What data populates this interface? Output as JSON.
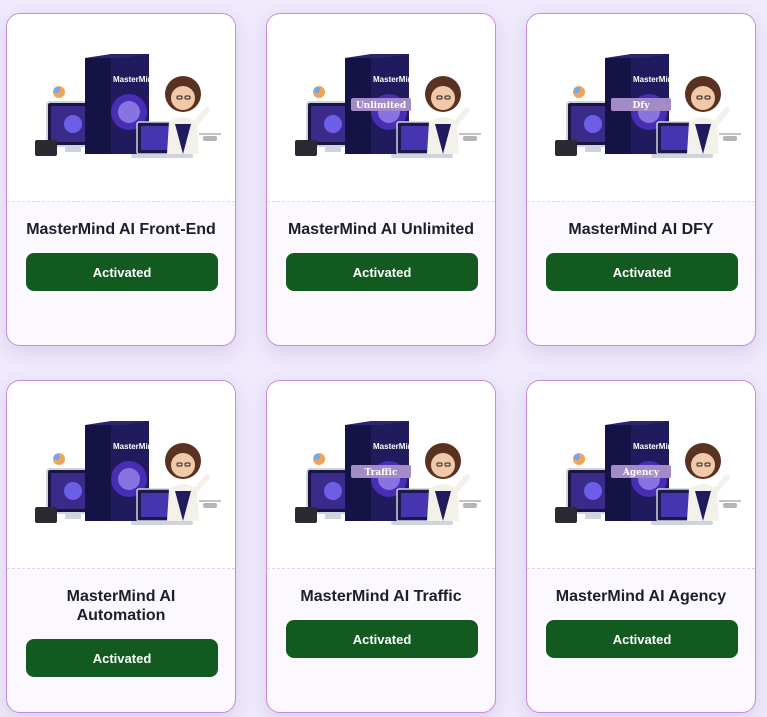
{
  "cards": [
    {
      "title": "MasterMind AI Front-End",
      "button": "Activated",
      "variant": ""
    },
    {
      "title": "MasterMind AI Unlimited",
      "button": "Activated",
      "variant": "Unlimited"
    },
    {
      "title": "MasterMind AI DFY",
      "button": "Activated",
      "variant": "Dfy"
    },
    {
      "title": "MasterMind AI Automation",
      "button": "Activated",
      "variant": ""
    },
    {
      "title": "MasterMind AI Traffic",
      "button": "Activated",
      "variant": "Traffic"
    },
    {
      "title": "MasterMind AI Agency",
      "button": "Activated",
      "variant": "Agency"
    }
  ],
  "product_logo_text": "MasterMind",
  "colors": {
    "page_bg": "#efeafc",
    "card_bg": "#fcf8ff",
    "card_border": "#c98ad6",
    "button_bg": "#135a20",
    "button_text": "#ffffff"
  }
}
